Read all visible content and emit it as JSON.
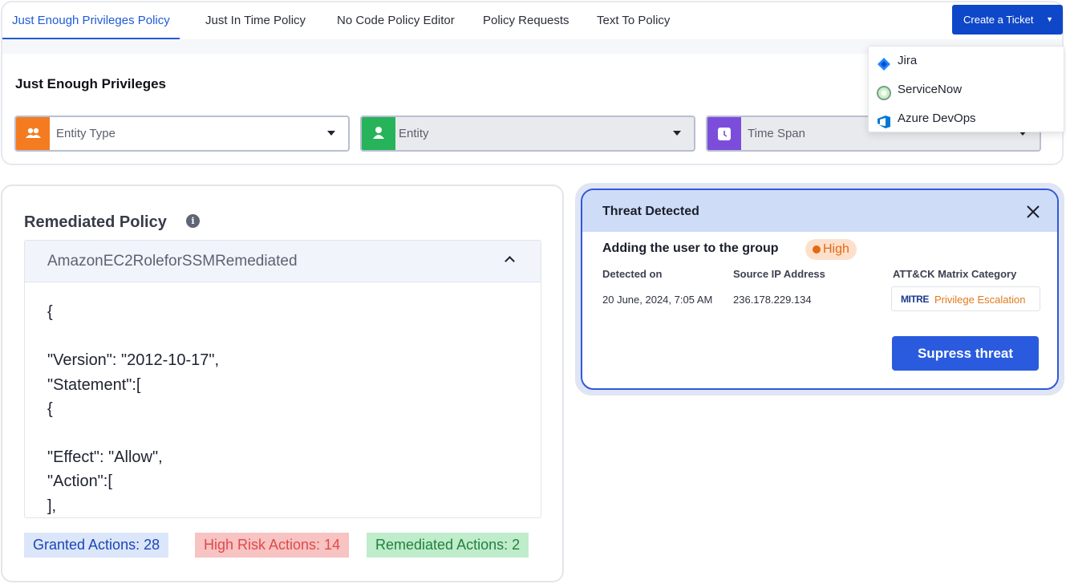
{
  "tabs": [
    {
      "label": "Just Enough Privileges Policy",
      "active": true
    },
    {
      "label": "Just In Time Policy"
    },
    {
      "label": "No Code Policy Editor"
    },
    {
      "label": "Policy Requests"
    },
    {
      "label": "Text To Policy"
    }
  ],
  "ticket": {
    "button_label": "Create a Ticket",
    "options": [
      {
        "label": "Jira",
        "icon": "jira-icon"
      },
      {
        "label": "ServiceNow",
        "icon": "servicenow-icon"
      },
      {
        "label": "Azure DevOps",
        "icon": "azure-devops-icon"
      }
    ]
  },
  "section_title": "Just Enough Privileges",
  "filters": [
    {
      "label": "Entity Type",
      "icon": "users-icon",
      "color": "#f47b20"
    },
    {
      "label": "Entity",
      "icon": "user-icon",
      "color": "#27b35a"
    },
    {
      "label": "Time Span",
      "icon": "clock-icon",
      "color": "#7c4ddb"
    }
  ],
  "policy": {
    "title": "Remediated Policy",
    "name": "AmazonEC2RoleforSSMRemediated",
    "code_lines": [
      "{",
      "",
      "\"Version\": \"2012-10-17\",",
      "\"Statement\":[",
      "{",
      "",
      "\"Effect\": \"Allow\",",
      "\"Action\":[",
      "],"
    ],
    "stats": {
      "granted": "Granted Actions: 28",
      "high_risk": "High Risk Actions: 14",
      "remediated": "Remediated Actions: 2"
    }
  },
  "threat": {
    "title": "Threat Detected",
    "description": "Adding the user to the group",
    "severity": "High",
    "columns": {
      "detected_on": "Detected on",
      "source_ip": "Source IP Address",
      "category": "ATT&CK Matrix Category"
    },
    "values": {
      "detected_on": "20 June, 2024, 7:05 AM",
      "source_ip": "236.178.229.134",
      "mitre_logo": "MITRE",
      "category": "Privilege Escalation"
    },
    "action_label": "Supress threat"
  },
  "colors": {
    "accent": "#1f5bd6",
    "primary_button": "#0f47c9",
    "severity_high": "#e36a12"
  }
}
